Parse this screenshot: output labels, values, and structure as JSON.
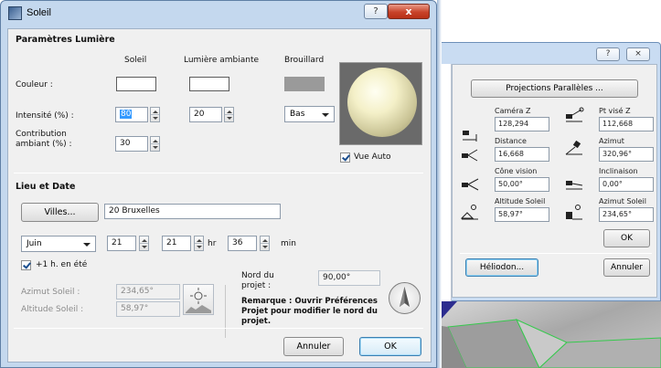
{
  "camera_dialog": {
    "help_label": "?",
    "close_label": "×",
    "projection_button": "Projections Parallèles ...",
    "fields": [
      {
        "label": "Caméra Z",
        "value": "128,294",
        "icon": "camera-z-icon"
      },
      {
        "label": "Pt visé Z",
        "value": "112,668",
        "icon": "target-z-icon"
      },
      {
        "label": "Distance",
        "value": "16,668",
        "icon": "distance-icon"
      },
      {
        "label": "Azimut",
        "value": "320,96°",
        "icon": "azimuth-icon"
      },
      {
        "label": "Cône vision",
        "value": "50,00°",
        "icon": "view-cone-icon"
      },
      {
        "label": "Inclinaison",
        "value": "0,00°",
        "icon": "tilt-icon"
      },
      {
        "label": "Altitude Soleil",
        "value": "58,97°",
        "icon": "sun-altitude-icon"
      },
      {
        "label": "Azimut Soleil",
        "value": "234,65°",
        "icon": "sun-azimuth-icon"
      }
    ],
    "ok_label": "OK",
    "heliodon_label": "Héliodon...",
    "cancel_label": "Annuler"
  },
  "soleil": {
    "title": "Soleil",
    "help_label": "?",
    "close_label": "x",
    "light": {
      "section": "Paramètres Lumière",
      "col_soleil": "Soleil",
      "col_ambient": "Lumière ambiante",
      "col_fog": "Brouillard",
      "color_label": "Couleur :",
      "intensity_label": "Intensité (%) :",
      "intensity_sun": "80",
      "intensity_ambient": "20",
      "fog_value": "Bas",
      "contribution_label_1": "Contribution",
      "contribution_label_2": "ambiant (%) :",
      "contribution_value": "30",
      "auto_view": "Vue Auto"
    },
    "place": {
      "section": "Lieu et Date",
      "cities_button": "Villes...",
      "city": "20 Bruxelles",
      "month": "Juin",
      "day": "21",
      "hour": "21",
      "hour_unit": "hr",
      "minute": "36",
      "minute_unit": "min",
      "summer_time": "+1 h. en été",
      "sun_azimuth_label": "Azimut Soleil :",
      "sun_azimuth": "234,65°",
      "sun_altitude_label": "Altitude Soleil :",
      "sun_altitude": "58,97°",
      "north_label_1": "Nord du",
      "north_label_2": "projet :",
      "north_value": "90,00°",
      "remark_1": "Remarque : Ouvrir Préférences",
      "remark_2": "Projet pour modifier le nord du",
      "remark_3": "projet."
    },
    "cancel_label": "Annuler",
    "ok_label": "OK"
  }
}
